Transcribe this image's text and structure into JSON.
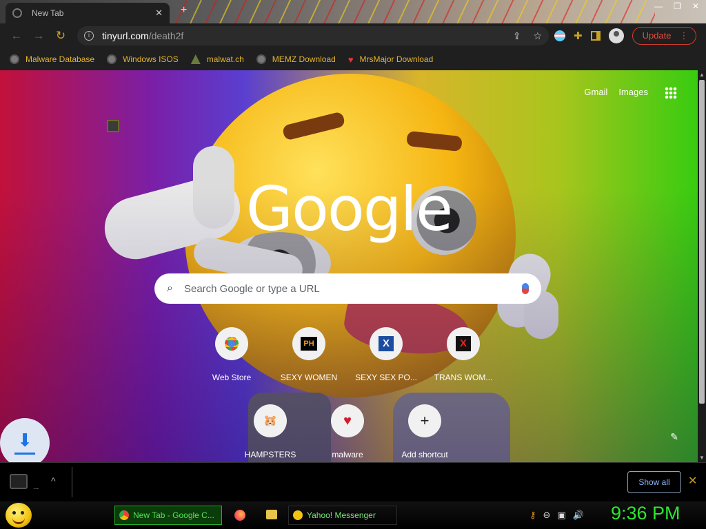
{
  "tab": {
    "title": "New Tab",
    "close": "✕",
    "new_tab": "+"
  },
  "window": {
    "minimize": "—",
    "maximize": "❐",
    "close": "✕"
  },
  "toolbar": {
    "back": "←",
    "forward": "→",
    "reload": "↻",
    "url_host": "tinyurl.com",
    "url_path": "/death2f",
    "share": "⇪",
    "star": "☆",
    "update_label": "Update",
    "menu": "⋮"
  },
  "bookmarks": [
    {
      "label": "Malware Database",
      "icon": "globe-icon"
    },
    {
      "label": "Windows ISOS",
      "icon": "globe-icon"
    },
    {
      "label": "malwat.ch",
      "icon": "biohazard-icon"
    },
    {
      "label": "MEMZ Download",
      "icon": "globe-icon"
    },
    {
      "label": "MrsMajor Download",
      "icon": "heart-icon"
    }
  ],
  "ntp": {
    "gmail": "Gmail",
    "images": "Images",
    "logo": "Google",
    "search_placeholder": "Search Google or type a URL",
    "shortcuts": [
      {
        "label": "Web Store",
        "icon": "chrome-webstore-icon"
      },
      {
        "label": "SEXY WOMEN",
        "icon_text": "PH"
      },
      {
        "label": "SEXY SEX PO...",
        "icon_text": "X"
      },
      {
        "label": "TRANS WOM...",
        "icon_text": "X"
      },
      {
        "label": "HAMPSTERS",
        "icon_text": "🐹"
      },
      {
        "label": "malware",
        "icon_text": "♥"
      },
      {
        "label": "Add shortcut",
        "icon_text": "+"
      }
    ],
    "customize": "✎"
  },
  "download_shelf": {
    "dots": "...",
    "caret": "^",
    "show_all": "Show all",
    "close": "✕"
  },
  "taskbar": {
    "chrome_task": "New Tab - Google C...",
    "yahoo_task": "Yahoo! Messenger",
    "clock": "9:36 PM"
  },
  "colors": {
    "accent": "#c9a227",
    "update": "#e34a3a",
    "clock": "#2ee62e"
  }
}
